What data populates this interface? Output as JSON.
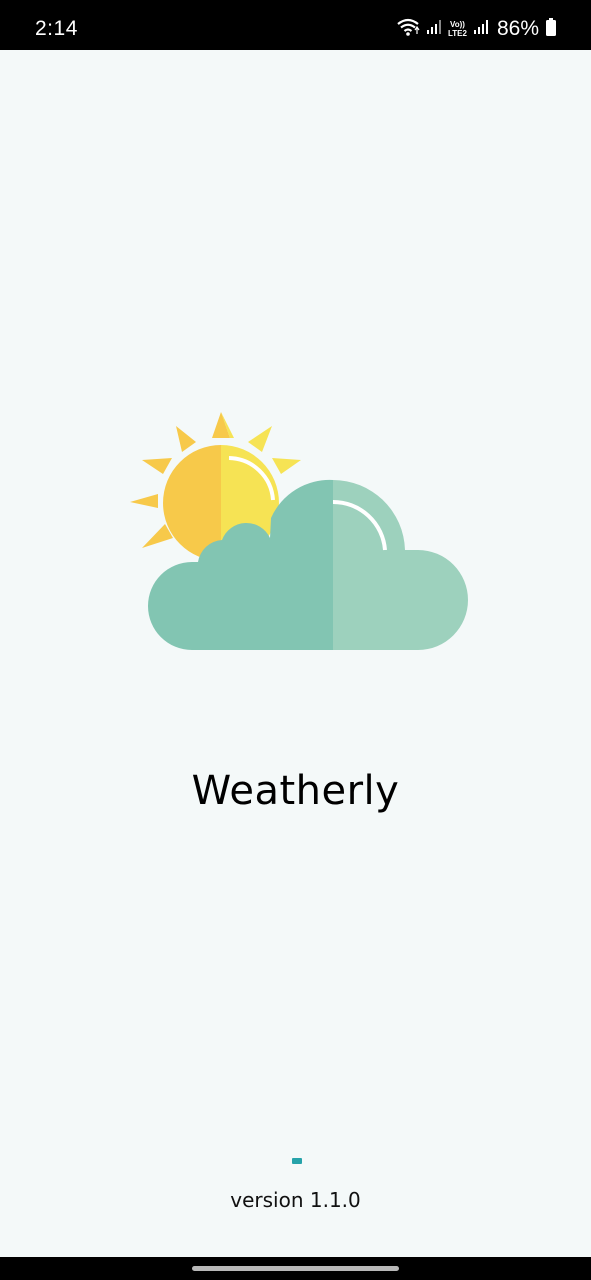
{
  "status_bar": {
    "time": "2:14",
    "lte_top": "Vo))",
    "lte_bottom": "LTE2",
    "battery_percent": "86%",
    "icons": [
      "wifi-icon",
      "signal-icon",
      "lte-icon",
      "signal-icon",
      "battery-icon"
    ]
  },
  "app": {
    "title": "Weatherly",
    "version": "version 1.1.0"
  },
  "colors": {
    "background": "#f4f9f9",
    "sun_dark": "#f7c94a",
    "sun_light": "#f6e354",
    "cloud_dark": "#82c5b2",
    "cloud_light": "#9dd1bd",
    "progress": "#26a3aa"
  }
}
